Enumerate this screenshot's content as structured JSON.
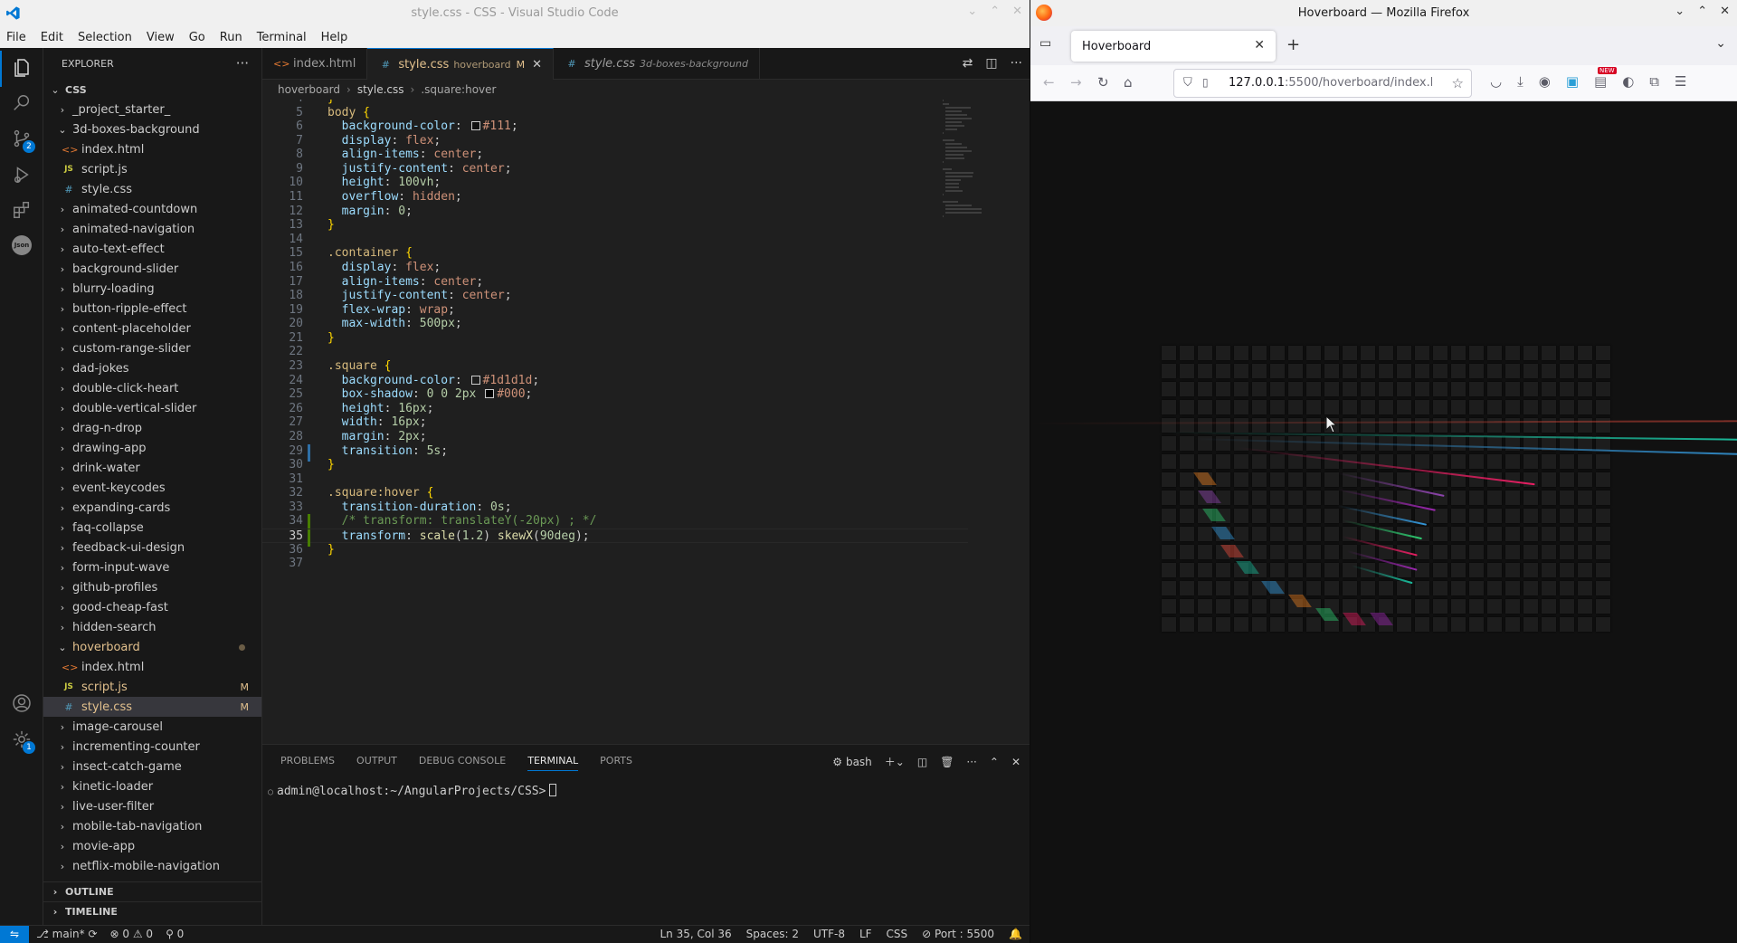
{
  "vscode": {
    "window_title": "style.css - CSS - Visual Studio Code",
    "menu": [
      "File",
      "Edit",
      "Selection",
      "View",
      "Go",
      "Run",
      "Terminal",
      "Help"
    ],
    "activity_badges": {
      "source_control": "2",
      "manage": "1"
    },
    "activity_json_label": "Json",
    "explorer": {
      "title": "EXPLORER",
      "root": "CSS",
      "items": [
        {
          "label": "_project_starter_",
          "type": "folder",
          "open": false,
          "depth": 1
        },
        {
          "label": "3d-boxes-background",
          "type": "folder",
          "open": true,
          "depth": 1
        },
        {
          "label": "index.html",
          "type": "html",
          "depth": 2
        },
        {
          "label": "script.js",
          "type": "js",
          "depth": 2
        },
        {
          "label": "style.css",
          "type": "css",
          "depth": 2
        },
        {
          "label": "animated-countdown",
          "type": "folder",
          "open": false,
          "depth": 1
        },
        {
          "label": "animated-navigation",
          "type": "folder",
          "open": false,
          "depth": 1
        },
        {
          "label": "auto-text-effect",
          "type": "folder",
          "open": false,
          "depth": 1
        },
        {
          "label": "background-slider",
          "type": "folder",
          "open": false,
          "depth": 1
        },
        {
          "label": "blurry-loading",
          "type": "folder",
          "open": false,
          "depth": 1
        },
        {
          "label": "button-ripple-effect",
          "type": "folder",
          "open": false,
          "depth": 1
        },
        {
          "label": "content-placeholder",
          "type": "folder",
          "open": false,
          "depth": 1
        },
        {
          "label": "custom-range-slider",
          "type": "folder",
          "open": false,
          "depth": 1
        },
        {
          "label": "dad-jokes",
          "type": "folder",
          "open": false,
          "depth": 1
        },
        {
          "label": "double-click-heart",
          "type": "folder",
          "open": false,
          "depth": 1
        },
        {
          "label": "double-vertical-slider",
          "type": "folder",
          "open": false,
          "depth": 1
        },
        {
          "label": "drag-n-drop",
          "type": "folder",
          "open": false,
          "depth": 1
        },
        {
          "label": "drawing-app",
          "type": "folder",
          "open": false,
          "depth": 1
        },
        {
          "label": "drink-water",
          "type": "folder",
          "open": false,
          "depth": 1
        },
        {
          "label": "event-keycodes",
          "type": "folder",
          "open": false,
          "depth": 1
        },
        {
          "label": "expanding-cards",
          "type": "folder",
          "open": false,
          "depth": 1
        },
        {
          "label": "faq-collapse",
          "type": "folder",
          "open": false,
          "depth": 1
        },
        {
          "label": "feedback-ui-design",
          "type": "folder",
          "open": false,
          "depth": 1
        },
        {
          "label": "form-input-wave",
          "type": "folder",
          "open": false,
          "depth": 1
        },
        {
          "label": "github-profiles",
          "type": "folder",
          "open": false,
          "depth": 1
        },
        {
          "label": "good-cheap-fast",
          "type": "folder",
          "open": false,
          "depth": 1
        },
        {
          "label": "hidden-search",
          "type": "folder",
          "open": false,
          "depth": 1
        },
        {
          "label": "hoverboard",
          "type": "folder",
          "open": true,
          "depth": 1,
          "modified": true,
          "dot": true
        },
        {
          "label": "index.html",
          "type": "html",
          "depth": 2
        },
        {
          "label": "script.js",
          "type": "js",
          "depth": 2,
          "modified": true,
          "mark": "M"
        },
        {
          "label": "style.css",
          "type": "css",
          "depth": 2,
          "modified": true,
          "mark": "M",
          "selected": true
        },
        {
          "label": "image-carousel",
          "type": "folder",
          "open": false,
          "depth": 1
        },
        {
          "label": "incrementing-counter",
          "type": "folder",
          "open": false,
          "depth": 1
        },
        {
          "label": "insect-catch-game",
          "type": "folder",
          "open": false,
          "depth": 1
        },
        {
          "label": "kinetic-loader",
          "type": "folder",
          "open": false,
          "depth": 1
        },
        {
          "label": "live-user-filter",
          "type": "folder",
          "open": false,
          "depth": 1
        },
        {
          "label": "mobile-tab-navigation",
          "type": "folder",
          "open": false,
          "depth": 1
        },
        {
          "label": "movie-app",
          "type": "folder",
          "open": false,
          "depth": 1
        },
        {
          "label": "netflix-mobile-navigation",
          "type": "folder",
          "open": false,
          "depth": 1
        }
      ],
      "outline_label": "OUTLINE",
      "timeline_label": "TIMELINE"
    },
    "tabs": [
      {
        "name": "index.html",
        "desc": "",
        "active": false
      },
      {
        "name": "style.css",
        "desc": "hoverboard",
        "mark": "M",
        "active": true
      },
      {
        "name": "style.css",
        "desc": "3d-boxes-background",
        "active": false
      }
    ],
    "breadcrumb": [
      "hoverboard",
      "style.css",
      ".square:hover"
    ],
    "code_lines": [
      {
        "n": "4",
        "text": "}"
      },
      {
        "n": "5",
        "text": "body {"
      },
      {
        "n": "6",
        "text": "  background-color: #111;"
      },
      {
        "n": "7",
        "text": "  display: flex;"
      },
      {
        "n": "8",
        "text": "  align-items: center;"
      },
      {
        "n": "9",
        "text": "  justify-content: center;"
      },
      {
        "n": "10",
        "text": "  height: 100vh;"
      },
      {
        "n": "11",
        "text": "  overflow: hidden;"
      },
      {
        "n": "12",
        "text": "  margin: 0;"
      },
      {
        "n": "13",
        "text": "}"
      },
      {
        "n": "14",
        "text": ""
      },
      {
        "n": "15",
        "text": ".container {"
      },
      {
        "n": "16",
        "text": "  display: flex;"
      },
      {
        "n": "17",
        "text": "  align-items: center;"
      },
      {
        "n": "18",
        "text": "  justify-content: center;"
      },
      {
        "n": "19",
        "text": "  flex-wrap: wrap;"
      },
      {
        "n": "20",
        "text": "  max-width: 500px;"
      },
      {
        "n": "21",
        "text": "}"
      },
      {
        "n": "22",
        "text": ""
      },
      {
        "n": "23",
        "text": ".square {"
      },
      {
        "n": "24",
        "text": "  background-color: #1d1d1d;"
      },
      {
        "n": "25",
        "text": "  box-shadow: 0 0 2px #000;"
      },
      {
        "n": "26",
        "text": "  height: 16px;"
      },
      {
        "n": "27",
        "text": "  width: 16px;"
      },
      {
        "n": "28",
        "text": "  margin: 2px;"
      },
      {
        "n": "29",
        "text": "  transition: 5s;"
      },
      {
        "n": "30",
        "text": "}"
      },
      {
        "n": "31",
        "text": ""
      },
      {
        "n": "32",
        "text": ".square:hover {"
      },
      {
        "n": "33",
        "text": "  transition-duration: 0s;"
      },
      {
        "n": "34",
        "text": "  /* transform: translateY(-20px) ; */"
      },
      {
        "n": "35",
        "text": "  transform: scale(1.2) skewX(90deg);"
      },
      {
        "n": "36",
        "text": "}"
      },
      {
        "n": "37",
        "text": ""
      }
    ],
    "panel": {
      "tabs": [
        "PROBLEMS",
        "OUTPUT",
        "DEBUG CONSOLE",
        "TERMINAL",
        "PORTS"
      ],
      "active_tab": "TERMINAL",
      "shell_label": "bash",
      "prompt": "admin@localhost:~/AngularProjects/CSS>"
    },
    "status": {
      "branch": "main*",
      "errors": "0",
      "warnings": "0",
      "ports_fwd": "0",
      "cursor": "Ln 35, Col 36",
      "spaces": "Spaces: 2",
      "encoding": "UTF-8",
      "eol": "LF",
      "language": "CSS",
      "port": "Port : 5500"
    }
  },
  "firefox": {
    "window_title": "Hoverboard — Mozilla Firefox",
    "tab_title": "Hoverboard",
    "url_host": "127.0.0.1",
    "url_path": ":5500/hoverboard/index.h",
    "badge_new": "NEW",
    "page": {
      "background": "#111111",
      "square_color": "#1d1d1d",
      "grid_count": 400,
      "accent_colors": [
        "#e74c3c",
        "#8e44ad",
        "#3498db",
        "#e67e22",
        "#2ecc71",
        "#1abc9c",
        "#e91e63",
        "#9c27b0"
      ]
    }
  }
}
